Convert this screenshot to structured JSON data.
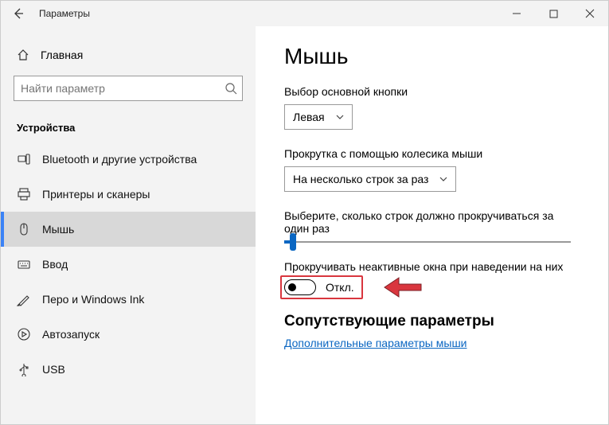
{
  "titlebar": {
    "title": "Параметры"
  },
  "sidebar": {
    "home": "Главная",
    "search_placeholder": "Найти параметр",
    "section": "Устройства",
    "items": [
      {
        "label": "Bluetooth и другие устройства"
      },
      {
        "label": "Принтеры и сканеры"
      },
      {
        "label": "Мышь"
      },
      {
        "label": "Ввод"
      },
      {
        "label": "Перо и Windows Ink"
      },
      {
        "label": "Автозапуск"
      },
      {
        "label": "USB"
      }
    ]
  },
  "content": {
    "title": "Мышь",
    "primary_button": {
      "label": "Выбор основной кнопки",
      "value": "Левая"
    },
    "scroll_mode": {
      "label": "Прокрутка с помощью колесика мыши",
      "value": "На несколько строк за раз"
    },
    "lines_per_scroll": {
      "label": "Выберите, сколько строк должно прокручиваться за один раз"
    },
    "inactive_scroll": {
      "label": "Прокручивать неактивные окна при наведении на них",
      "state": "Откл."
    },
    "related": {
      "title": "Сопутствующие параметры",
      "link": "Дополнительные параметры мыши"
    }
  }
}
